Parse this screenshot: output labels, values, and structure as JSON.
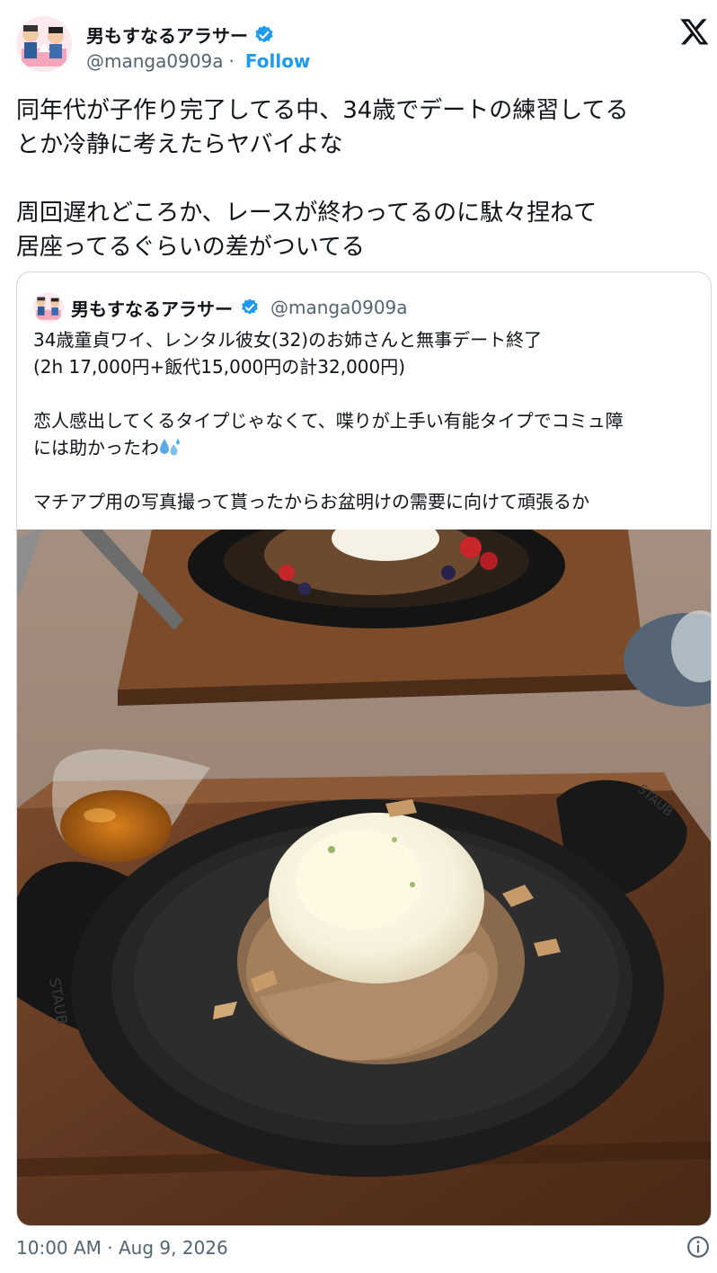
{
  "author": {
    "display_name": "男もすなるアラサー",
    "handle": "@manga0909a",
    "follow_label": "Follow",
    "separator": "·",
    "verified_icon": "verified-badge-icon"
  },
  "tweet": {
    "text": "同年代が子作り完了してる中、34歳でデートの練習してる\nとか冷静に考えたらヤバイよな\n\n周回遅れどころか、レースが終わってるのに駄々捏ねて\n居座ってるぐらいの差がついてる"
  },
  "quote": {
    "display_name": "男もすなるアラサー",
    "handle": "@manga0909a",
    "text_before_emoji": "34歳童貞ワイ、レンタル彼女(32)のお姉さんと無事デート終了\n(2h 17,000円+飯代15,000円の計32,000円)\n\n恋人感出してくるタイプじゃなくて、喋りが上手い有能タイプでコミュ障\nには助かったわ",
    "text_after_emoji": "\n\nマチアプ用の写真撮って貰ったからお盆明けの需要に向けて頑張るか",
    "emoji_icon": "sweat-droplets-icon"
  },
  "footer": {
    "timestamp": "10:00 AM · Aug 9, 2026",
    "info_icon": "info-icon"
  },
  "colors": {
    "accent": "#1d9bf0",
    "secondary_text": "#536471",
    "border": "#cfd9de"
  }
}
